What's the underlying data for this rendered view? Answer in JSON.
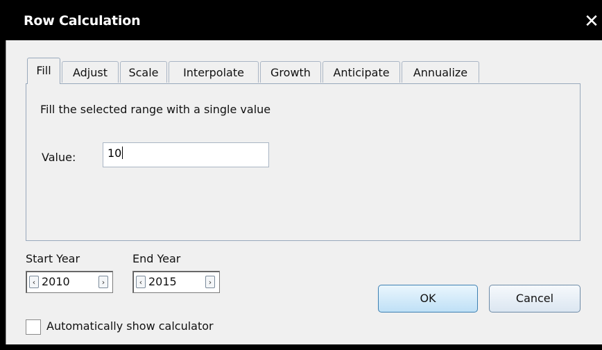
{
  "window": {
    "title": "Row Calculation",
    "close_glyph": "✕"
  },
  "tabs": [
    {
      "label": "Fill",
      "active": true
    },
    {
      "label": "Adjust"
    },
    {
      "label": "Scale"
    },
    {
      "label": "Interpolate"
    },
    {
      "label": "Growth"
    },
    {
      "label": "Anticipate"
    },
    {
      "label": "Annualize"
    }
  ],
  "fill": {
    "description": "Fill the selected range with a single value",
    "value_label": "Value:",
    "value": "10"
  },
  "start_year": {
    "label": "Start Year",
    "value": "2010",
    "prev_glyph": "‹",
    "next_glyph": "›"
  },
  "end_year": {
    "label": "End Year",
    "value": "2015",
    "prev_glyph": "‹",
    "next_glyph": "›"
  },
  "buttons": {
    "ok": "OK",
    "cancel": "Cancel"
  },
  "auto_calc": {
    "label": "Automatically show calculator",
    "checked": false
  }
}
